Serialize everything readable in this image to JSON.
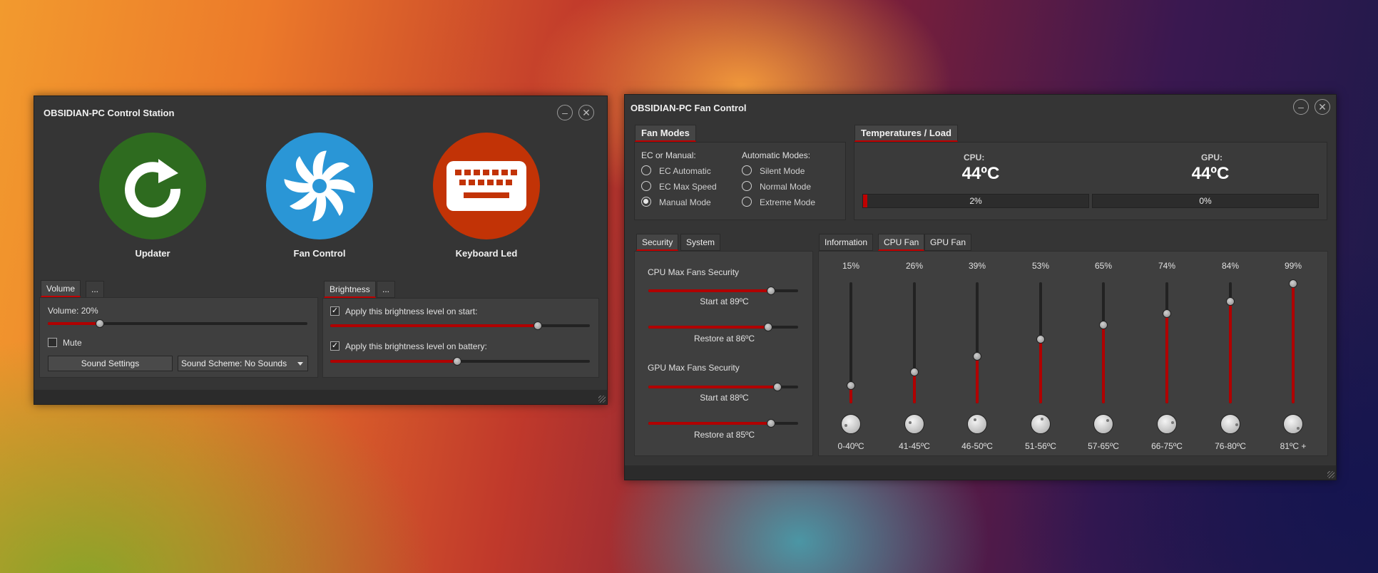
{
  "window1": {
    "title": "OBSIDIAN-PC Control Station",
    "minimize_icon": "minimize-icon",
    "close_icon": "close-icon",
    "apps": [
      {
        "label": "Updater",
        "icon": "refresh-icon",
        "color": "#2e6b1f"
      },
      {
        "label": "Fan Control",
        "icon": "fan-icon",
        "color": "#2a96d6"
      },
      {
        "label": "Keyboard Led",
        "icon": "keyboard-icon",
        "color": "#c23306"
      }
    ],
    "volume": {
      "tab": "Volume",
      "more_tab": "...",
      "label": "Volume: 20%",
      "value": 0.2,
      "mute_label": "Mute",
      "mute_checked": false,
      "sound_settings": "Sound Settings",
      "sound_scheme": "Sound Scheme: No Sounds"
    },
    "brightness": {
      "tab": "Brightness",
      "more_tab": "...",
      "start_label": "Apply this brightness level on start:",
      "start_checked": true,
      "start_value": 0.8,
      "battery_label": "Apply this brightness level on battery:",
      "battery_checked": true,
      "battery_value": 0.49
    }
  },
  "window2": {
    "title": "OBSIDIAN-PC Fan Control",
    "fan_modes": {
      "header": "Fan Modes",
      "ec_title": "EC or Manual:",
      "ec_options": [
        {
          "label": "EC Automatic",
          "selected": false
        },
        {
          "label": "EC Max Speed",
          "selected": false
        },
        {
          "label": "Manual Mode",
          "selected": true
        }
      ],
      "auto_title": "Automatic Modes:",
      "auto_options": [
        {
          "label": "Silent Mode",
          "selected": false
        },
        {
          "label": "Normal Mode",
          "selected": false
        },
        {
          "label": "Extreme Mode",
          "selected": false
        }
      ]
    },
    "temps": {
      "header": "Temperatures / Load",
      "cpu_label": "CPU:",
      "cpu_temp": "44ºC",
      "cpu_load_label": "2%",
      "cpu_load": 0.02,
      "gpu_label": "GPU:",
      "gpu_temp": "44ºC",
      "gpu_load_label": "0%",
      "gpu_load": 0.0
    },
    "security": {
      "tabs": [
        "Security",
        "System"
      ],
      "cpu_title": "CPU Max Fans Security",
      "cpu_start": "Start at 89ºC",
      "cpu_start_value": 0.82,
      "cpu_restore": "Restore at 86ºC",
      "cpu_restore_value": 0.8,
      "gpu_title": "GPU Max Fans Security",
      "gpu_start": "Start at 88ºC",
      "gpu_start_value": 0.86,
      "gpu_restore": "Restore at 85ºC",
      "gpu_restore_value": 0.82
    },
    "fan_tabs": [
      "Information",
      "CPU Fan",
      "GPU Fan"
    ],
    "fan_curve": [
      {
        "percent": "15%",
        "value": 0.15,
        "range": "0-40ºC"
      },
      {
        "percent": "26%",
        "value": 0.26,
        "range": "41-45ºC"
      },
      {
        "percent": "39%",
        "value": 0.39,
        "range": "46-50ºC"
      },
      {
        "percent": "53%",
        "value": 0.53,
        "range": "51-56ºC"
      },
      {
        "percent": "65%",
        "value": 0.65,
        "range": "57-65ºC"
      },
      {
        "percent": "74%",
        "value": 0.74,
        "range": "66-75ºC"
      },
      {
        "percent": "84%",
        "value": 0.84,
        "range": "76-80ºC"
      },
      {
        "percent": "99%",
        "value": 0.99,
        "range": "81ºC +"
      }
    ]
  }
}
